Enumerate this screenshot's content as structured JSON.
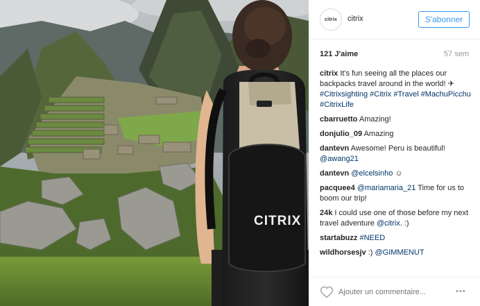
{
  "photo": {
    "backpack_logo": "CITRIX"
  },
  "header": {
    "avatar_text": "citrix",
    "username": "citrix",
    "follow_label": "S'abonner"
  },
  "stats": {
    "likes": "121 J'aime",
    "time": "57 sem"
  },
  "comments": [
    {
      "user": "citrix",
      "text": "It's fun seeing all the places our backpacks travel around in the world! ✈ ",
      "link": "#Citrixsighting #Citrix #Travel #MachuPicchu #CitrixLife",
      "after": ""
    },
    {
      "user": "cbarruetto",
      "text": "Amazing!",
      "link": "",
      "after": ""
    },
    {
      "user": "donjulio_09",
      "text": "Amazing",
      "link": "",
      "after": ""
    },
    {
      "user": "dantevn",
      "text": "Awesome! Peru is beautiful! ",
      "link": "@awang21",
      "after": ""
    },
    {
      "user": "dantevn",
      "text": "",
      "link": "@elcelsinho",
      "after": " ☺"
    },
    {
      "user": "pacquee4",
      "text": "",
      "link": "@mariamaria_21",
      "after": " Time for us to boom our trip!"
    },
    {
      "user": "24k",
      "text": "I could use one of those before my next travel adventure ",
      "link": "@citrix",
      "after": ". :)"
    },
    {
      "user": "startabuzz",
      "text": "",
      "link": "#NEED",
      "after": ""
    },
    {
      "user": "wildhorsesjv",
      "text": ":) ",
      "link": "@GIMMENUT",
      "after": ""
    }
  ],
  "footer": {
    "comment_placeholder": "Ajouter un commentaire...",
    "more_label": "•••"
  }
}
